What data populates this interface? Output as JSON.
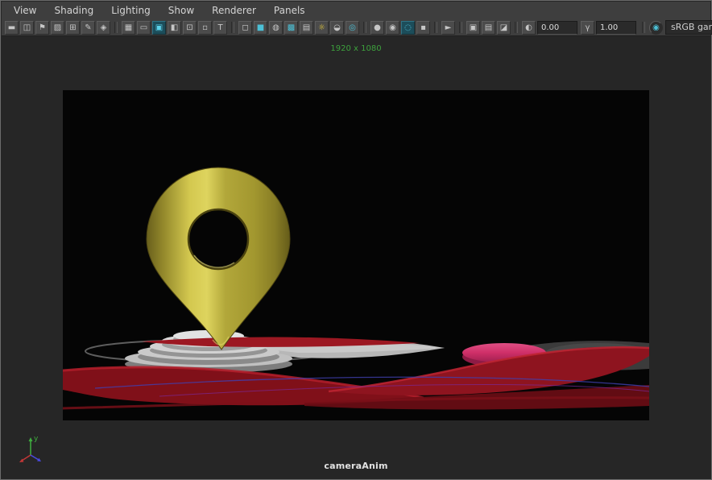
{
  "menubar": {
    "items": [
      "View",
      "Shading",
      "Lighting",
      "Show",
      "Renderer",
      "Panels"
    ]
  },
  "toolbar": {
    "icons": {
      "select_camera": "▬",
      "camera_attributes": "◫",
      "bookmark": "⚑",
      "image_plane": "▨",
      "pan_zoom": "⊞",
      "grease_pencil": "✎",
      "camera_tools": "◈",
      "grid": "▦",
      "film_gate": "▭",
      "resolution_gate": "▣",
      "gate_mask": "◧",
      "field_chart": "⊡",
      "safe_action": "▫",
      "safe_title": "T",
      "wireframe": "◻",
      "smooth_shade": "■",
      "wireframe_on_shaded": "◍",
      "textured": "▩",
      "default_material": "▤",
      "lights": "☼",
      "shadows": "◒",
      "ssao": "◎",
      "isolate_select": "●",
      "isolate_view": "◉",
      "fog": "◌",
      "plain_square": "▪",
      "select_tool": "►",
      "xray": "▣",
      "xray_joints": "▤",
      "xray_active": "◪",
      "exposure": "◐",
      "gamma": "γ",
      "view_transform": "◉"
    },
    "exposure_value": "0.00",
    "gamma_value": "1.00",
    "view_transform_label": "sRGB gamma"
  },
  "viewport": {
    "resolution_label": "1920 x 1080",
    "camera_label": "cameraAnim",
    "axis": {
      "y_label": "y"
    }
  },
  "colors": {
    "chrome_bg": "#3e3e3e",
    "viewport_bg": "#262626",
    "render_bg": "#000000",
    "pin_gold": "#d3c84f",
    "ribbon_red": "#8e141f",
    "disc_pink": "#cf2f68",
    "podium_gray": "#c3c3c3",
    "accent_teal": "#4cc0d6",
    "resolution_text_green": "#3da13d"
  }
}
